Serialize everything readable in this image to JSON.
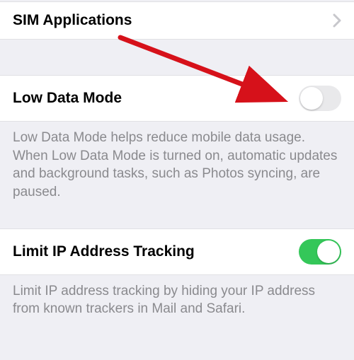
{
  "simApps": {
    "label": "SIM Applications"
  },
  "lowDataMode": {
    "label": "Low Data Mode",
    "on": false,
    "description": "Low Data Mode helps reduce mobile data usage. When Low Data Mode is turned on, automatic updates and background tasks, such as Photos syncing, are paused."
  },
  "limitIpTracking": {
    "label": "Limit IP Address Tracking",
    "on": true,
    "description": "Limit IP address tracking by hiding your IP address from known trackers in Mail and Safari."
  }
}
